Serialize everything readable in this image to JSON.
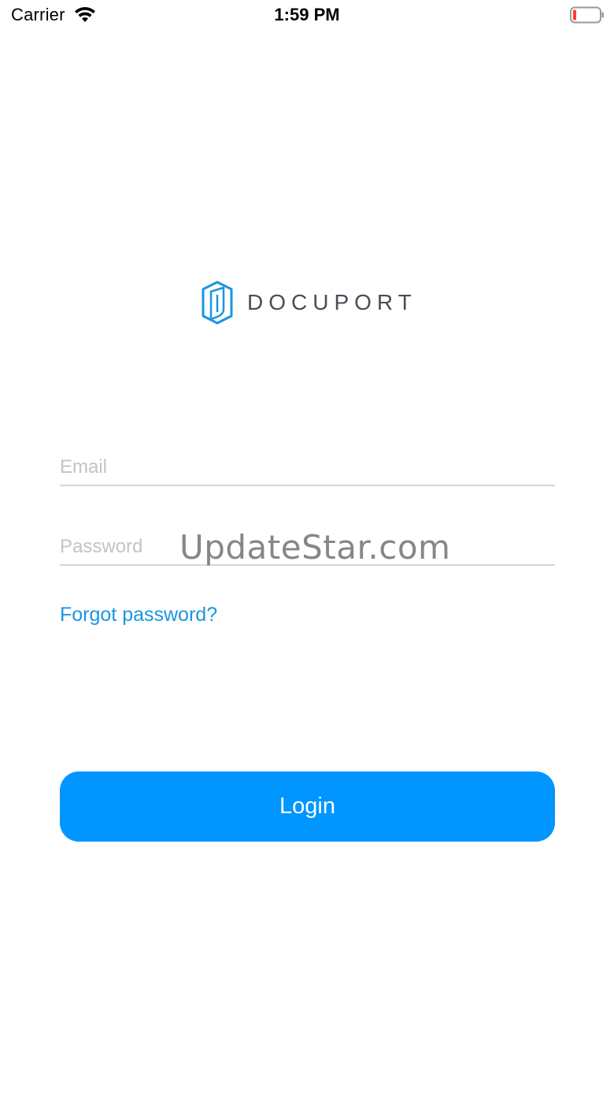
{
  "status_bar": {
    "carrier": "Carrier",
    "time": "1:59 PM",
    "battery_level_color": "#ff3b30"
  },
  "logo": {
    "text": "DOCUPORT",
    "mark_color": "#1a95e2"
  },
  "login_form": {
    "email_placeholder": "Email",
    "password_placeholder": "Password",
    "forgot_label": "Forgot password?",
    "login_label": "Login"
  },
  "watermark": {
    "text": "UpdateStar.com"
  },
  "colors": {
    "accent": "#0095ff",
    "link": "#1a95e2",
    "placeholder": "#c3c3c8",
    "divider": "#d6d6d6"
  }
}
